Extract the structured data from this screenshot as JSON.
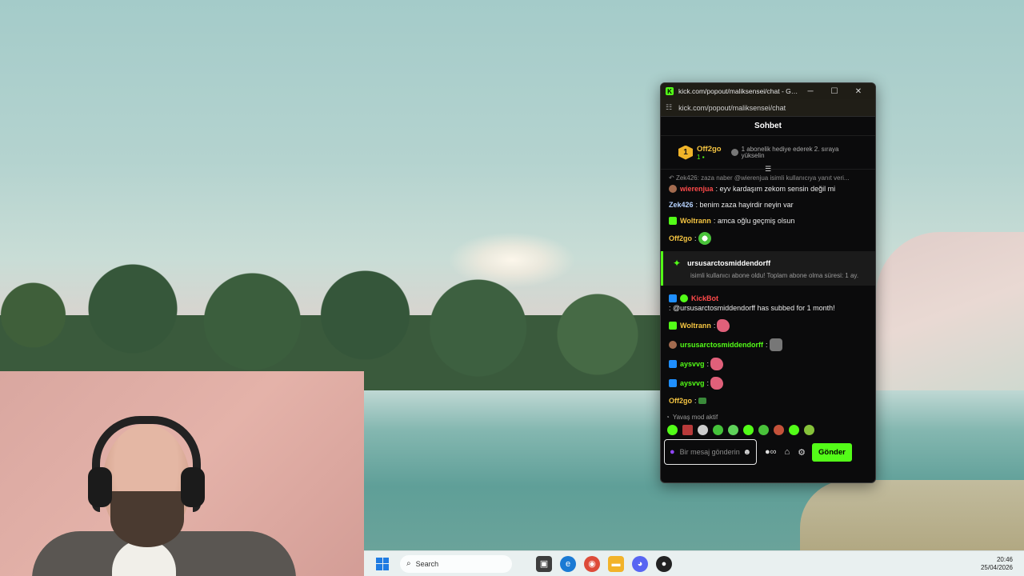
{
  "window": {
    "title": "kick.com/popout/maliksensei/chat - Google...",
    "url": "kick.com/popout/maliksensei/chat",
    "logo_letter": "K"
  },
  "chat": {
    "header": "Sohbet",
    "leader": {
      "rank": "1",
      "name": "Off2go",
      "count": "1",
      "gift_prompt": "1 abonelik hediye ederek 2. sıraya yükselin"
    },
    "reply_preview": "Zek426: zaza naber @wierenjua isimli kullanıcıya yanıt veri...",
    "messages": [
      {
        "user": "wierenjua",
        "text": "eyv kardaşım zekom sensin değil mi",
        "color": "#ff4a4a"
      },
      {
        "user": "Zek426",
        "text": "benim zaza hayirdir neyin var",
        "color": "#b6d2ff"
      },
      {
        "user": "Woltrann",
        "text": "amca oğlu geçmiş olsun",
        "color": "#f5c542"
      },
      {
        "user": "Off2go",
        "text": "",
        "color": "#f5c542"
      }
    ],
    "subscription": {
      "user": "ursusarctosmiddendorff",
      "text": "isimli kullanıcı abone oldu! Toplam abone olma süresi: 1 ay."
    },
    "messages2": [
      {
        "user": "KickBot",
        "text": "@ursusarctosmiddendorff has subbed for 1 month!",
        "color": "#ff4a4a"
      },
      {
        "user": "Woltrann",
        "text": "",
        "color": "#f5c542"
      },
      {
        "user": "ursusarctosmiddendorff",
        "text": "",
        "color": "#53fc18"
      },
      {
        "user": "aysvvg",
        "text": "",
        "color": "#53fc18"
      },
      {
        "user": "aysvvg",
        "text": "",
        "color": "#53fc18"
      },
      {
        "user": "Off2go",
        "text": "",
        "color": "#f5c542"
      },
      {
        "user": "ursusarctosmiddendorff",
        "text": "",
        "color": "#53fc18"
      }
    ],
    "slow_mode": "Yavaş mod aktif",
    "input_placeholder": "Bir mesaj gönderin",
    "send_label": "Gönder"
  },
  "taskbar": {
    "search_label": "Search",
    "time": "20:46",
    "date": "25/04/2026"
  },
  "colors": {
    "kick_green": "#53fc18",
    "gold": "#f5c542"
  }
}
